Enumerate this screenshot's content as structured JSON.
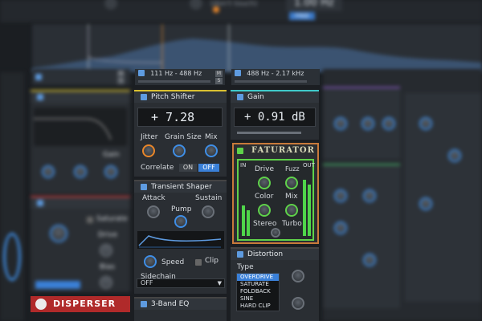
{
  "top": {
    "note": "(don't touch)",
    "freq": "1.00 Hz",
    "free_label": "FREE"
  },
  "bands": [
    {
      "label": "111 Hz - 488 Hz"
    },
    {
      "label": "488 Hz - 2.17 kHz"
    }
  ],
  "pitch_shifter": {
    "title": "Pitch Shifter",
    "value": "+   7.28",
    "jitter": "Jitter",
    "grain_size": "Grain Size",
    "mix": "Mix",
    "correlate": "Correlate",
    "on": "ON",
    "off": "OFF"
  },
  "gain": {
    "title": "Gain",
    "value": "+   0.91 dB"
  },
  "faturator": {
    "title": "FATURATOR",
    "in": "IN",
    "out": "OUT",
    "drive": "Drive",
    "fuzz": "Fuzz",
    "color": "Color",
    "mix": "Mix",
    "stereo": "Stereo",
    "turbo": "Turbo"
  },
  "transient_shaper": {
    "title": "Transient Shaper",
    "attack": "Attack",
    "sustain": "Sustain",
    "pump": "Pump",
    "speed": "Speed",
    "clip": "Clip",
    "sidechain": "Sidechain",
    "sidechain_value": "OFF"
  },
  "distortion": {
    "title": "Distortion",
    "type": "Type",
    "options": [
      "OVERDRIVE",
      "SATURATE",
      "FOLDBACK",
      "SINE",
      "HARD CLIP"
    ],
    "selected": "OVERDRIVE"
  },
  "three_band_eq": {
    "title": "3-Band EQ"
  },
  "left_panel": {
    "gain": "Gain",
    "saturate": "Saturate",
    "drive": "Drive",
    "bias": "Bias"
  },
  "disperser": {
    "title": "DISPERSER"
  },
  "colors": {
    "accent": "#3a80d8",
    "fat_border": "#c87a3a",
    "meter": "#4fd64a",
    "red": "#b02a2a"
  }
}
